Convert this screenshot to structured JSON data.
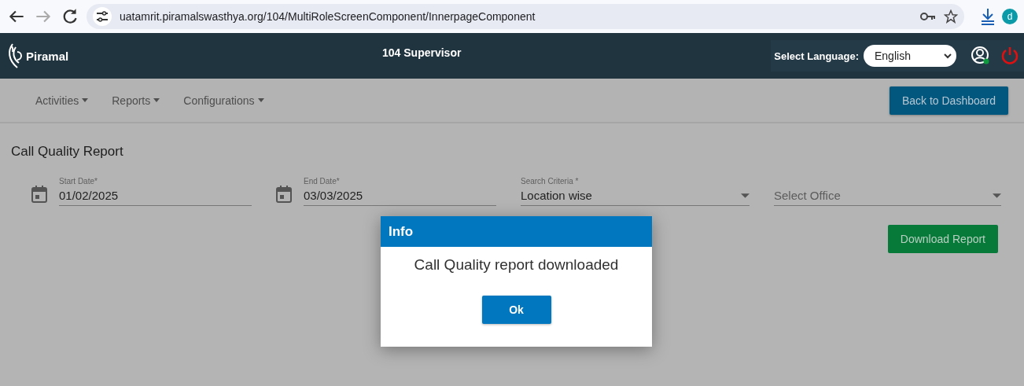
{
  "browser": {
    "url": "uatamrit.piramalswasthya.org/104/MultiRoleScreenComponent/InnerpageComponent",
    "profile": "d"
  },
  "header": {
    "brand": "Piramal",
    "title": "104 Supervisor",
    "language_label": "Select Language:",
    "language": "English"
  },
  "nav": {
    "menus": [
      "Activities",
      "Reports",
      "Configurations"
    ],
    "back_button": "Back to Dashboard"
  },
  "report": {
    "title": "Call Quality Report",
    "fields": [
      {
        "kind": "date",
        "label": "Start Date*",
        "value": "01/02/2025"
      },
      {
        "kind": "date",
        "label": "End Date*",
        "value": "03/03/2025"
      },
      {
        "kind": "select",
        "label": "Search Criteria *",
        "value": "Location wise"
      },
      {
        "kind": "select",
        "placeholder": "Select Office"
      }
    ],
    "download_button": "Download Report"
  },
  "dialog": {
    "title": "Info",
    "message": "Call Quality report downloaded",
    "button": "Ok"
  }
}
